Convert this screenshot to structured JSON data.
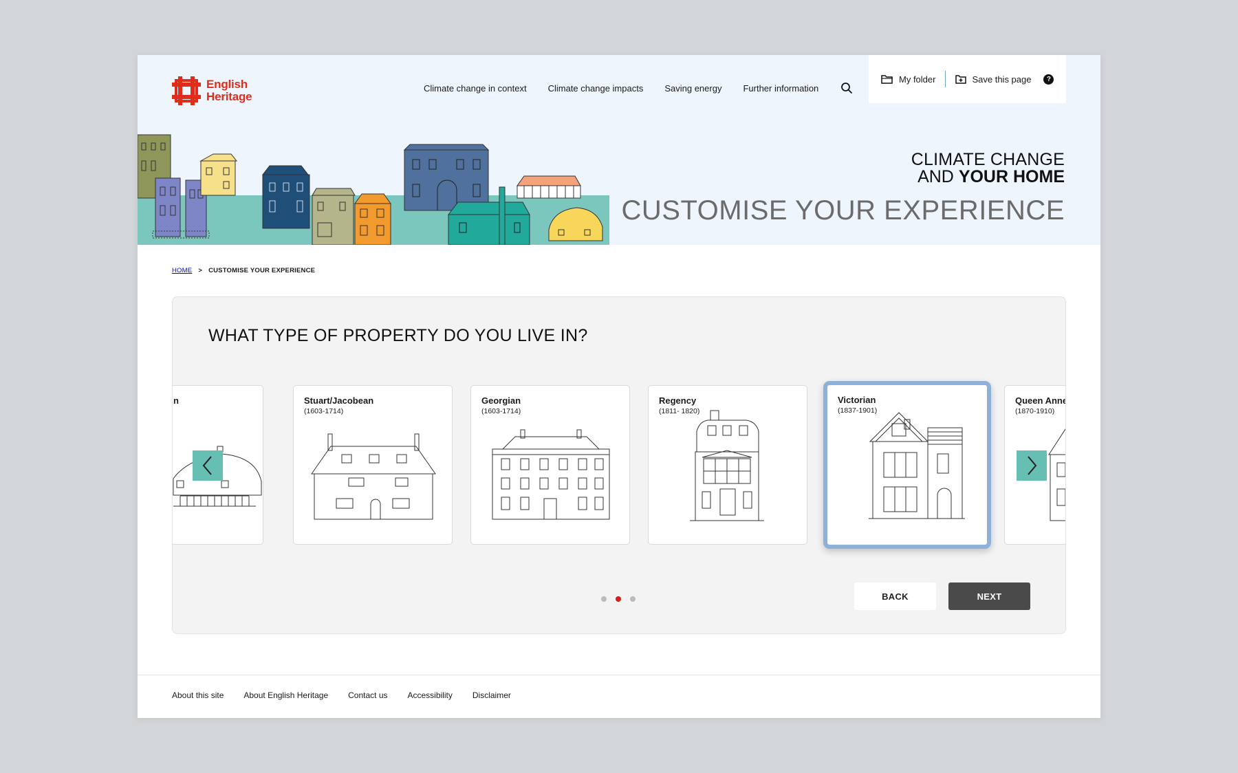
{
  "brand": {
    "line1": "English",
    "line2": "Heritage",
    "color": "#e02d1b"
  },
  "nav": {
    "items": [
      "Climate change in context",
      "Climate change impacts",
      "Saving energy",
      "Further information"
    ]
  },
  "utility": {
    "folder_label": "My folder",
    "save_label": "Save this page",
    "help": "?"
  },
  "hero": {
    "line1": "CLIMATE CHANGE",
    "line2_prefix": "AND ",
    "line2_bold": "YOUR HOME",
    "subtitle": "CUSTOMISE YOUR EXPERIENCE"
  },
  "breadcrumb": {
    "home": "HOME",
    "separator": ">",
    "current": "CUSTOMISE YOUR EXPERIENCE"
  },
  "question": "WHAT TYPE OF PROPERTY DO YOU LIVE IN?",
  "property_cards": [
    {
      "name": "n",
      "years": ""
    },
    {
      "name": "Stuart/Jacobean",
      "years": "(1603-1714)"
    },
    {
      "name": "Georgian",
      "years": "(1603-1714)"
    },
    {
      "name": "Regency",
      "years": "(1811- 1820)"
    },
    {
      "name": "Victorian",
      "years": "(1837-1901)",
      "selected": true
    },
    {
      "name": "Queen Anne",
      "years": "(1870-1910)"
    }
  ],
  "carousel": {
    "pages": 3,
    "active_page": 2
  },
  "buttons": {
    "back": "BACK",
    "next": "NEXT"
  },
  "footer": {
    "links": [
      "About this site",
      "About English Heritage",
      "Contact us",
      "Accessibility",
      "Disclaimer"
    ]
  },
  "colors": {
    "accent_teal": "#66bfb2",
    "selected_border": "#8db1d9",
    "active_dot": "#d21e1e",
    "hero_bg": "#eef5fc"
  }
}
